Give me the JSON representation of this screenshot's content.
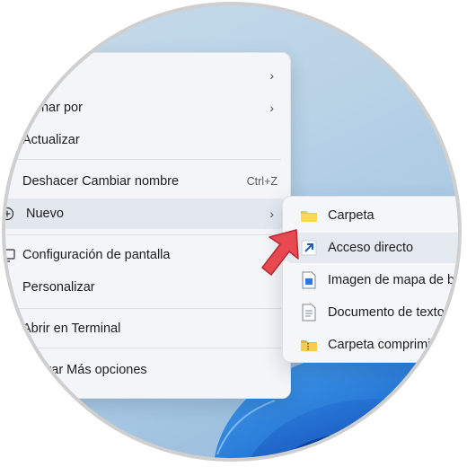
{
  "context_menu": {
    "items": [
      {
        "label": "",
        "has_submenu": true
      },
      {
        "label": "rdenar por",
        "has_submenu": true
      },
      {
        "label": "Actualizar",
        "has_submenu": false
      },
      {
        "label": "Deshacer Cambiar nombre",
        "shortcut": "Ctrl+Z"
      },
      {
        "label": "Nuevo",
        "has_submenu": true
      },
      {
        "label": "Configuración de pantalla"
      },
      {
        "label": "Personalizar"
      },
      {
        "label": "Abrir en Terminal"
      },
      {
        "label": "Mostrar Más opciones"
      }
    ],
    "chevron": "›"
  },
  "submenu": {
    "items": [
      {
        "label": "Carpeta",
        "icon": "folder-icon"
      },
      {
        "label": "Acceso directo",
        "icon": "shortcut-arrow-icon"
      },
      {
        "label": "Imagen de mapa de b",
        "icon": "bitmap-image-icon"
      },
      {
        "label": "Documento de texto",
        "icon": "text-document-icon"
      },
      {
        "label": "Carpeta comprimi",
        "icon": "zip-folder-icon"
      }
    ]
  },
  "colors": {
    "pointer": "#e8484f",
    "folder": "#f4c53e",
    "shortcut_arrow": "#1a5fb4",
    "hover": "#e3e8ee"
  }
}
